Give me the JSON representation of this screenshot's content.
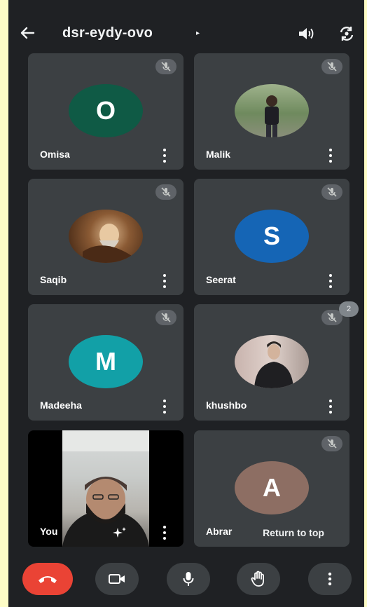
{
  "meeting": {
    "code": "dsr-eydy-ovo",
    "caret": "▸"
  },
  "icons": {
    "back": "arrow-left-icon",
    "speaker": "speaker-icon",
    "switch_camera": "switch-camera-icon",
    "mic_off": "mic-off-icon",
    "more": "more-vert-icon",
    "end_call": "phone-hangup-icon",
    "camera": "video-camera-icon",
    "mic": "microphone-icon",
    "raise_hand": "raise-hand-icon",
    "effects": "sparkle-effects-icon"
  },
  "participants": [
    {
      "name": "Omisa",
      "initial": "O",
      "avatar_color": "#0f5a45",
      "muted": true
    },
    {
      "name": "Malik",
      "initial": "",
      "avatar_color": "#7d8f72",
      "muted": true,
      "photo": true
    },
    {
      "name": "Saqib",
      "initial": "",
      "avatar_color": "#6b3a1e",
      "muted": true,
      "photo": true
    },
    {
      "name": "Seerat",
      "initial": "S",
      "avatar_color": "#1565b5",
      "muted": true
    },
    {
      "name": "Madeeha",
      "initial": "M",
      "avatar_color": "#12a0a7",
      "muted": true
    },
    {
      "name": "khushbo",
      "initial": "",
      "avatar_color": "#b8a6a0",
      "muted": true,
      "photo": true
    },
    {
      "name": "You",
      "initial": "",
      "muted": false,
      "self": true
    },
    {
      "name": "Abrar",
      "initial": "A",
      "avatar_color": "#8d6e63",
      "muted": true
    }
  ],
  "hidden_count": "2",
  "return_to_top": "Return to top",
  "colors": {
    "background": "#1f2124",
    "tile": "#3c4043",
    "end_call": "#ea4335",
    "page_border": "#fdfcc6"
  }
}
